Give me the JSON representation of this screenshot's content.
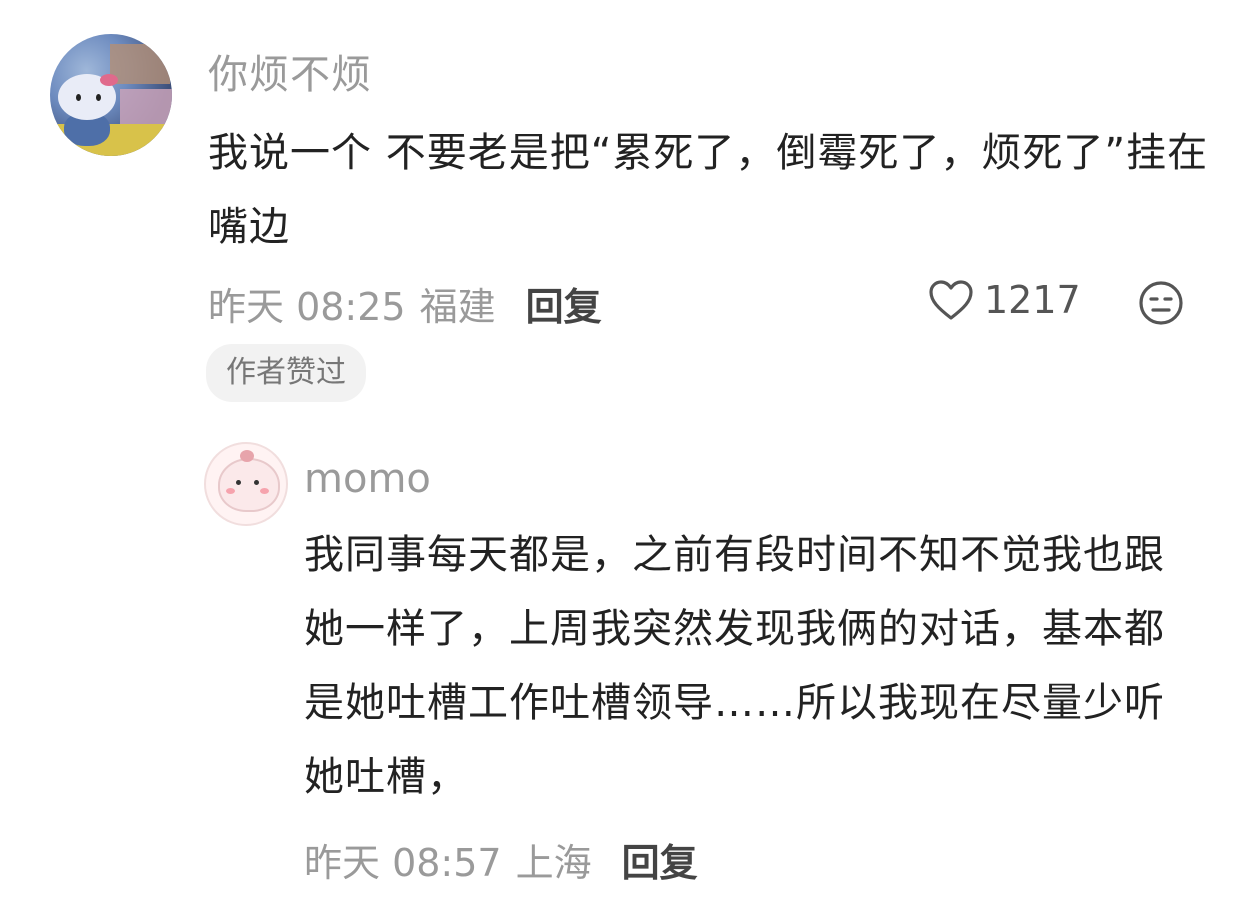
{
  "comment": {
    "username": "你烦不烦",
    "text": "我说一个 不要老是把“累死了，倒霉死了，烦死了”挂在嘴边",
    "time": "昨天 08:25",
    "location": "福建",
    "reply_label": "回复",
    "like_count": "1217",
    "author_liked_label": "作者赞过"
  },
  "reply": {
    "username": "momo",
    "text": "我同事每天都是，之前有段时间不知不觉我也跟她一样了，上周我突然发现我俩的对话，基本都是她吐槽工作吐槽领导……所以我现在尽量少听她吐槽，",
    "time": "昨天 08:57",
    "location": "上海",
    "reply_label": "回复"
  },
  "icons": {
    "like": "heart-outline-icon",
    "dislike": "meh-face-icon"
  }
}
